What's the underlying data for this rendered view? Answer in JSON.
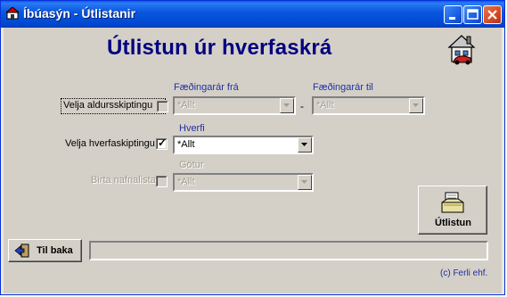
{
  "window": {
    "title": "Íbúasýn - Útlistanir"
  },
  "heading": "Útlistun úr  hverfaskrá",
  "age": {
    "checkbox_label": "Velja aldursskiptingu",
    "checked": false,
    "from_label": "Fæðingarár frá",
    "from_value": "*Allt",
    "to_label": "Fæðingarár til",
    "to_value": "*Allt",
    "separator": "-"
  },
  "district": {
    "checkbox_label": "Velja hverfaskiptingu",
    "checked": true,
    "label": "Hverfi",
    "value": "*Allt"
  },
  "streets": {
    "checkbox_label": "Birta nafnalista",
    "checked": false,
    "label": "Götur",
    "value": "*Allt"
  },
  "buttons": {
    "export": "Útlistun",
    "back": "Til baka"
  },
  "progress": 0,
  "copyright": "(c) Ferli ehf.",
  "icons": [
    "app-icon",
    "house-icon",
    "export-icon",
    "exit-door-icon",
    "minimize-icon",
    "maximize-icon",
    "close-icon",
    "dropdown-arrow-icon"
  ]
}
